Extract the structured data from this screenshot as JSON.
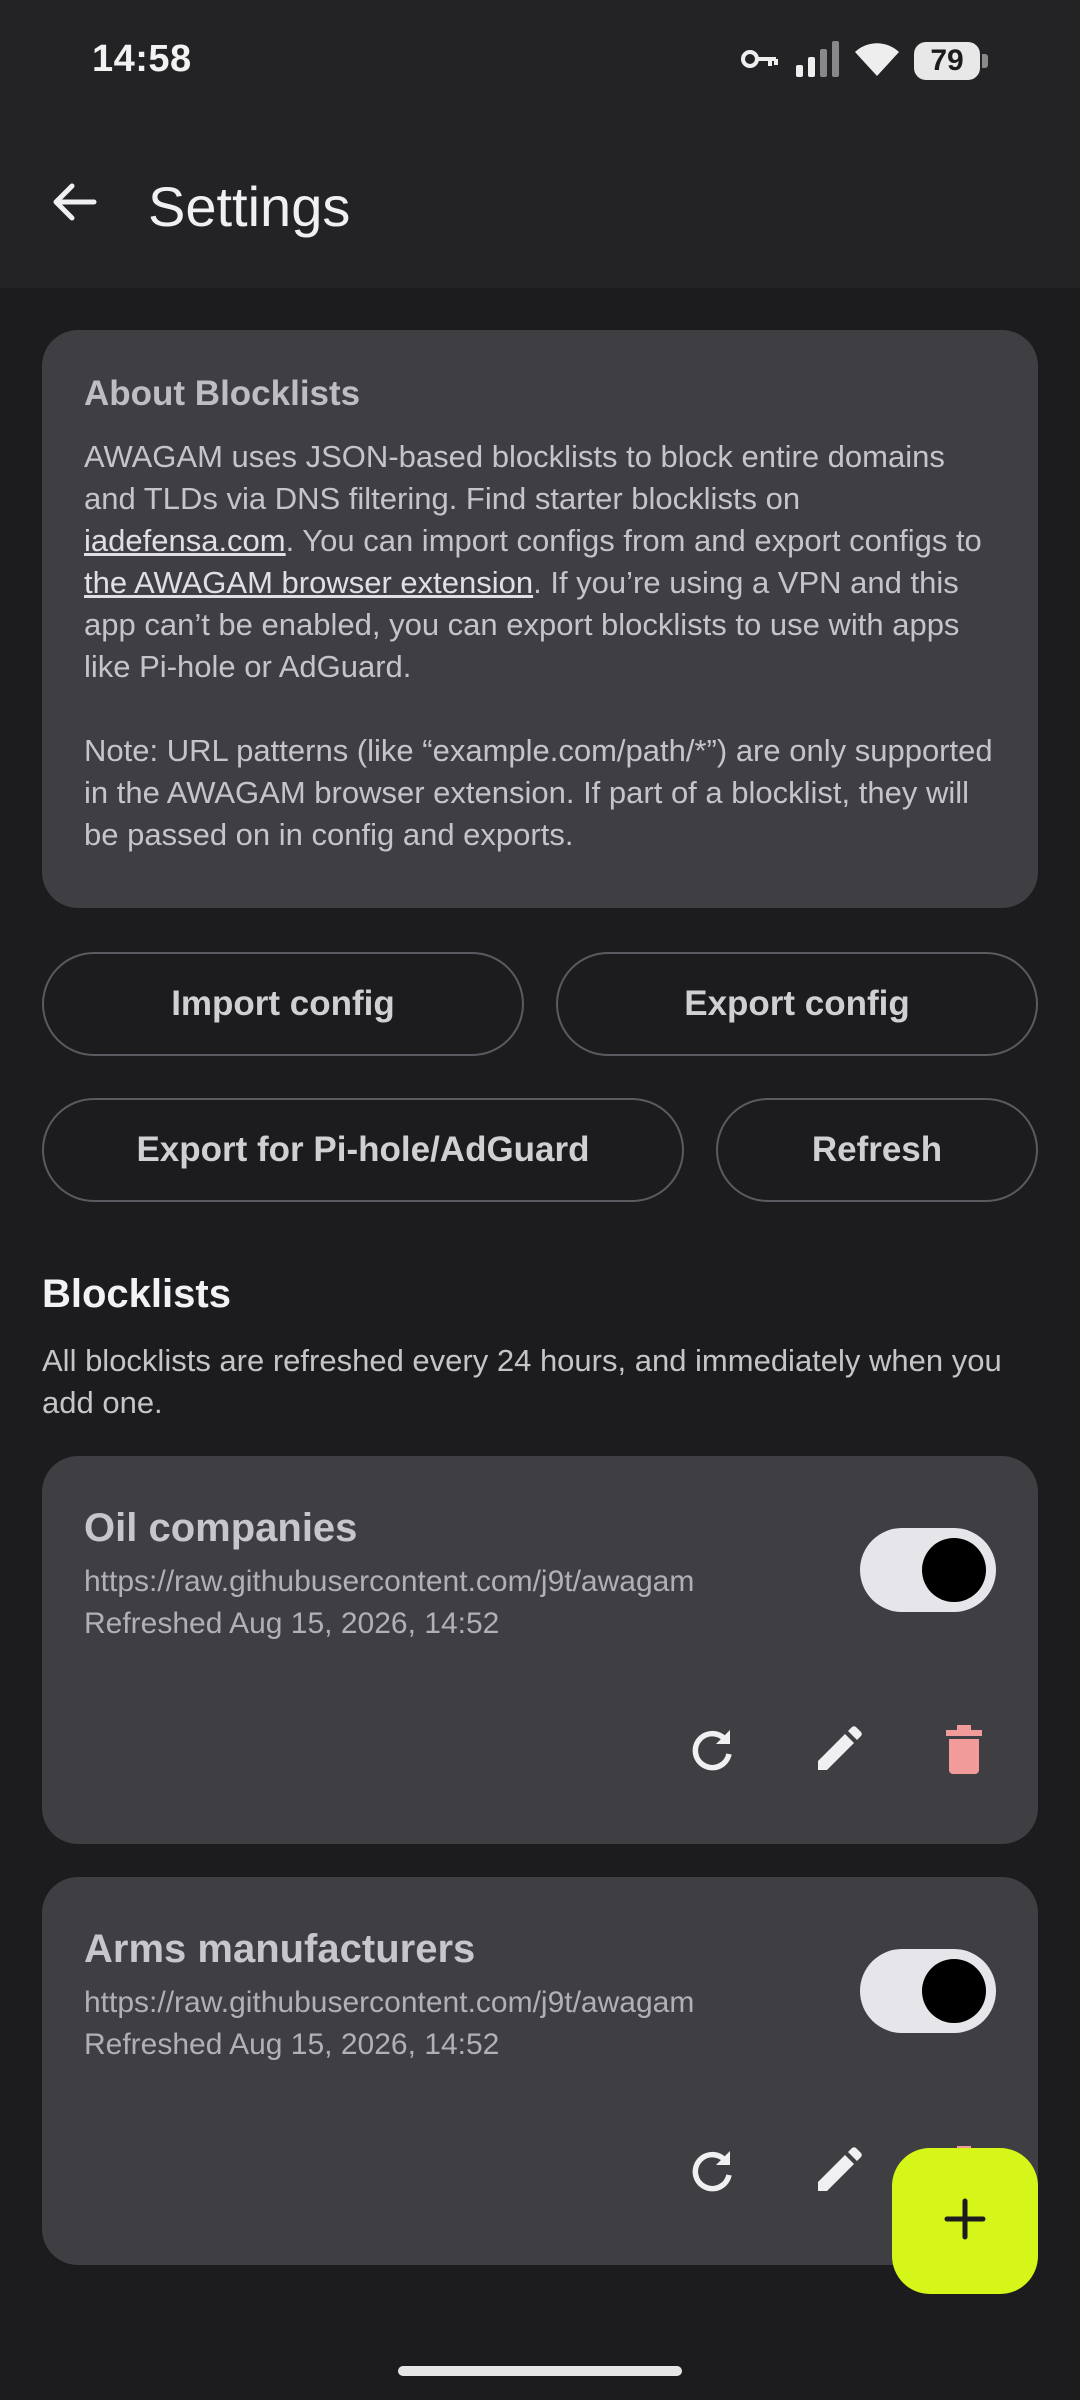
{
  "status_bar": {
    "time": "14:58",
    "battery": "79",
    "icons": [
      "key-icon",
      "signal-icon",
      "wifi-icon",
      "battery-icon"
    ]
  },
  "app_bar": {
    "title": "Settings",
    "back_icon": "arrow-left-icon"
  },
  "about": {
    "title": "About Blocklists",
    "text_1": "AWAGAM uses JSON-based blocklists to block entire domains and TLDs via DNS filtering. Find starter blocklists on ",
    "link_1": "iadefensa.com",
    "text_2": ". You can import configs from and export configs to ",
    "link_2": "the AWAGAM browser extension",
    "text_3": ". If you’re using a VPN and this app can’t be enabled, you can export blocklists to use with apps like Pi-hole or AdGuard.",
    "note": "Note: URL patterns (like “example.com/path/*”) are only supported in the AWAGAM browser extension. If part of a blocklist, they will be passed on in config and exports."
  },
  "actions": {
    "import_config": "Import config",
    "export_config": "Export config",
    "export_pihole": "Export for Pi-hole/AdGuard",
    "refresh": "Refresh"
  },
  "blocklists_section": {
    "title": "Blocklists",
    "subtitle": "All blocklists are refreshed every 24 hours, and immediately when you add one."
  },
  "blocklists": [
    {
      "name": "Oil companies",
      "url": "https://raw.githubusercontent.com/j9t/awagam",
      "refreshed": "Refreshed Aug 15, 2026, 14:52",
      "enabled": true
    },
    {
      "name": "Arms manufacturers",
      "url": "https://raw.githubusercontent.com/j9t/awagam",
      "refreshed": "Refreshed Aug 15, 2026, 14:52",
      "enabled": true
    }
  ],
  "fab": {
    "icon": "plus-icon"
  },
  "colors": {
    "background": "#1c1c1f",
    "card": "#3e3e43",
    "accent": "#d6f518",
    "delete": "#f29b9b"
  }
}
